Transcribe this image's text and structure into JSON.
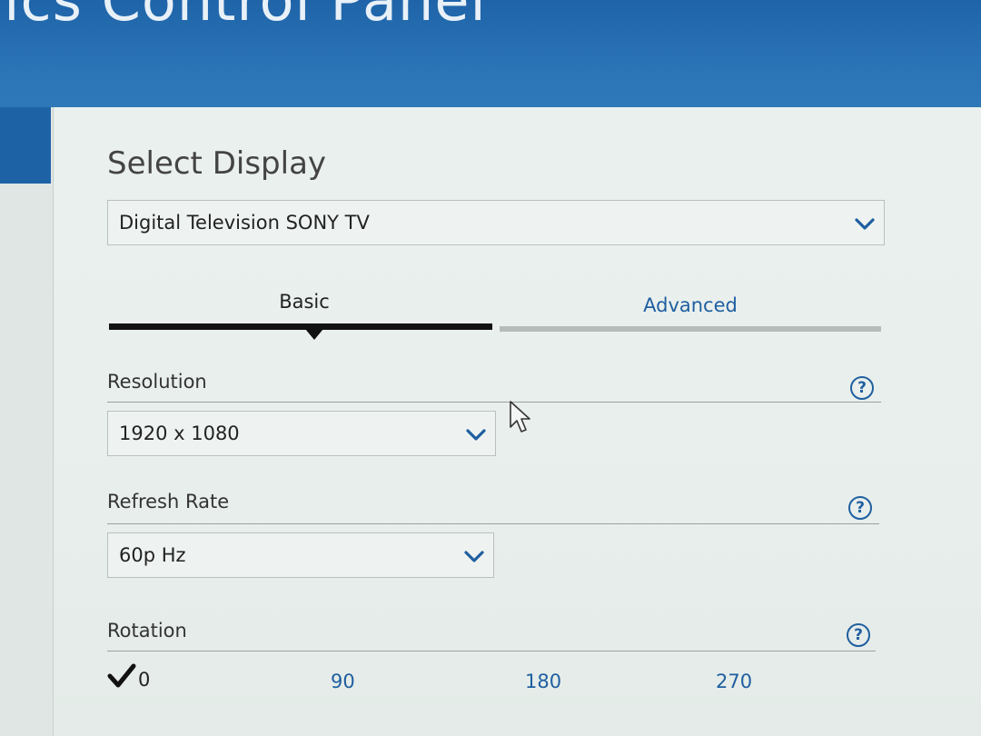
{
  "window": {
    "title": "nics Control Panel"
  },
  "colors": {
    "accent": "#1f5fa0",
    "titlebar": "#2a73b6",
    "text": "#333333"
  },
  "display": {
    "heading": "Select Display",
    "selected": "Digital Television SONY TV"
  },
  "tabs": [
    {
      "label": "Basic",
      "active": true
    },
    {
      "label": "Advanced",
      "active": false
    }
  ],
  "resolution": {
    "label": "Resolution",
    "value": "1920 x 1080",
    "help": "?"
  },
  "refresh": {
    "label": "Refresh Rate",
    "value": "60p Hz",
    "help": "?"
  },
  "rotation": {
    "label": "Rotation",
    "help": "?",
    "options": [
      "0",
      "90",
      "180",
      "270"
    ],
    "selected": "0"
  },
  "icons": {
    "dropdown": "chevron-down-icon",
    "help": "help-circle-icon",
    "check": "checkmark-icon",
    "cursor": "mouse-pointer-icon"
  }
}
